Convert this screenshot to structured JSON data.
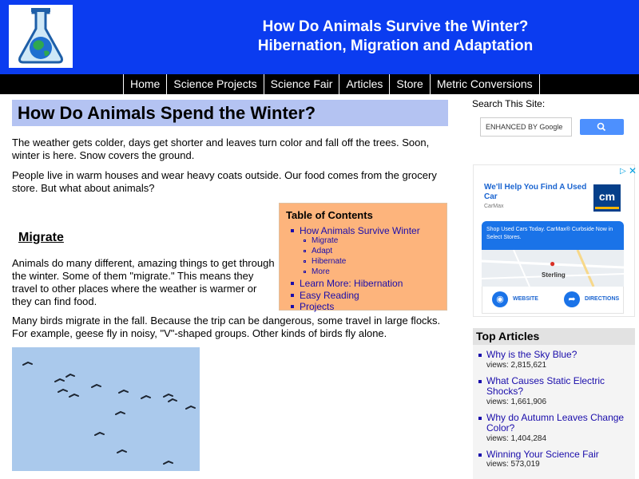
{
  "header": {
    "title_line1": "How Do Animals Survive the Winter?",
    "title_line2": "Hibernation, Migration and Adaptation",
    "logo_icon": "flask-globe-icon"
  },
  "nav": {
    "items": [
      "Home",
      "Science Projects",
      "Science Fair",
      "Articles",
      "Store",
      "Metric Conversions"
    ]
  },
  "main": {
    "heading": "How Do Animals Spend the Winter?",
    "p1": "The weather gets colder, days get shorter and leaves turn color and fall off the trees. Soon, winter is here. Snow covers the ground.",
    "p2": "People live in warm houses and wear heavy coats outside. Our food comes from the grocery store. But what about animals?",
    "migrate_heading": "Migrate",
    "p3": "Animals do many different, amazing things to get through the winter. Some of them \"migrate.\" This means they travel to other places where the weather is warmer or they can find food.",
    "p4": "Many birds migrate in the fall. Because the trip can be dangerous, some travel in large flocks. For example, geese fly in noisy, \"V\"-shaped groups. Other kinds of birds fly alone."
  },
  "toc": {
    "title": "Table of Contents",
    "items": [
      {
        "label": "How Animals Survive Winter",
        "level": 1
      },
      {
        "label": "Migrate",
        "level": 2
      },
      {
        "label": "Adapt",
        "level": 2
      },
      {
        "label": "Hibernate",
        "level": 2
      },
      {
        "label": "More",
        "level": 2
      },
      {
        "label": "Learn More: Hibernation",
        "level": 1
      },
      {
        "label": "Easy Reading",
        "level": 1
      },
      {
        "label": "Projects",
        "level": 1
      }
    ]
  },
  "sidebar": {
    "search_label": "Search This Site:",
    "search_placeholder": "ENHANCED BY Google",
    "ad": {
      "headline": "We'll Help You Find A Used Car",
      "brand": "CarMax",
      "logo_text": "cm",
      "description": "Shop Used Cars Today. CarMax® Curbside Now in Select Stores.",
      "map_label": "Sterling",
      "website_label": "WEBSITE",
      "directions_label": "DIRECTIONS"
    },
    "top_articles": {
      "title": "Top Articles",
      "items": [
        {
          "title": "Why is the Sky Blue?",
          "views": "views: 2,815,621"
        },
        {
          "title": "What Causes Static Electric Shocks?",
          "views": "views: 1,661,906"
        },
        {
          "title": "Why do Autumn Leaves Change Color?",
          "views": "views: 1,404,284"
        },
        {
          "title": "Winning Your Science Fair",
          "views": "views: 573,019"
        }
      ]
    }
  },
  "colors": {
    "header_bg": "#0b3cf0",
    "heading_bg": "#b4c3f2",
    "toc_bg": "#fdb47c",
    "link": "#1a0dab"
  }
}
